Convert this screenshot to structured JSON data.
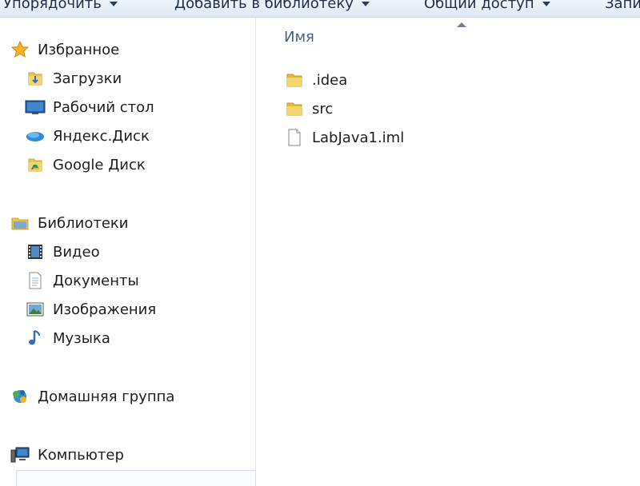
{
  "toolbar": {
    "organize_label": "Упорядочить",
    "add_to_library_label": "Добавить в библиотеку",
    "share_label": "Общий доступ",
    "burn_label": "Запи"
  },
  "nav": {
    "favorites": {
      "label": "Избранное",
      "items": [
        {
          "label": "Загрузки",
          "icon": "downloads-folder-icon"
        },
        {
          "label": "Рабочий стол",
          "icon": "desktop-icon"
        },
        {
          "label": "Яндекс.Диск",
          "icon": "yandex-disk-icon"
        },
        {
          "label": "Google Диск",
          "icon": "google-drive-folder-icon"
        }
      ]
    },
    "libraries": {
      "label": "Библиотеки",
      "items": [
        {
          "label": "Видео",
          "icon": "video-icon"
        },
        {
          "label": "Документы",
          "icon": "documents-icon"
        },
        {
          "label": "Изображения",
          "icon": "pictures-icon"
        },
        {
          "label": "Музыка",
          "icon": "music-icon"
        }
      ]
    },
    "homegroup": {
      "label": "Домашняя группа"
    },
    "computer": {
      "label": "Компьютер"
    }
  },
  "content": {
    "column_name": "Имя",
    "files": [
      {
        "name": ".idea",
        "type": "folder"
      },
      {
        "name": "src",
        "type": "folder"
      },
      {
        "name": "LabJava1.iml",
        "type": "file"
      }
    ]
  },
  "colors": {
    "folder_yellow": "#e9c74e",
    "accent_blue": "#2f6fb3"
  }
}
